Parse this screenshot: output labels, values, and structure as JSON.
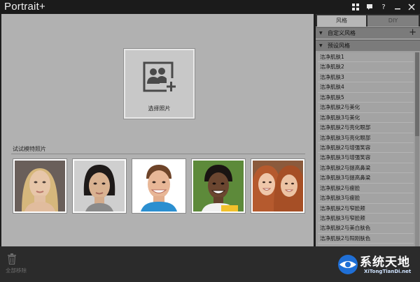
{
  "app": {
    "title": "Portrait+"
  },
  "titlebar": {
    "help_label": "?"
  },
  "canvas": {
    "select_photo_label": "选择照片",
    "model_heading": "试试模特照片",
    "thumbnails": [
      "face-1",
      "face-2",
      "face-3",
      "face-4",
      "face-5"
    ]
  },
  "panel": {
    "tabs": [
      {
        "label": "风格"
      },
      {
        "label": "DIY"
      }
    ],
    "custom_section": "自定义风格",
    "preset_section": "预设风格",
    "preset_items": [
      "洁净肌肤1",
      "洁净肌肤2",
      "洁净肌肤3",
      "洁净肌肤4",
      "洁净肌肤5",
      "洁净肌肤2与美化",
      "洁净肌肤3与美化",
      "洁净肌肤2与亮化眼部",
      "洁净肌肤3与亮化眼部",
      "洁净肌肤2与增强笑容",
      "洁净肌肤3与增强笑容",
      "洁净肌肤2与提高鼻梁",
      "洁净肌肤3与提高鼻梁",
      "洁净肌肤2与瘦脸",
      "洁净肌肤3与瘦脸",
      "洁净肌肤2与窄脸颊",
      "洁净肌肤3与窄脸颊",
      "洁净肌肤2与美白肤色",
      "洁净肌肤2与阳刚肤色"
    ]
  },
  "bottom": {
    "clear_label": "全部移除",
    "brand_main": "系统天地",
    "brand_sub": "XiTongTianDi.net"
  },
  "colors": {
    "canvas_bg": "#b1b1b1",
    "panel_bg": "#9e9e9e",
    "chrome": "#2b2b2b"
  }
}
